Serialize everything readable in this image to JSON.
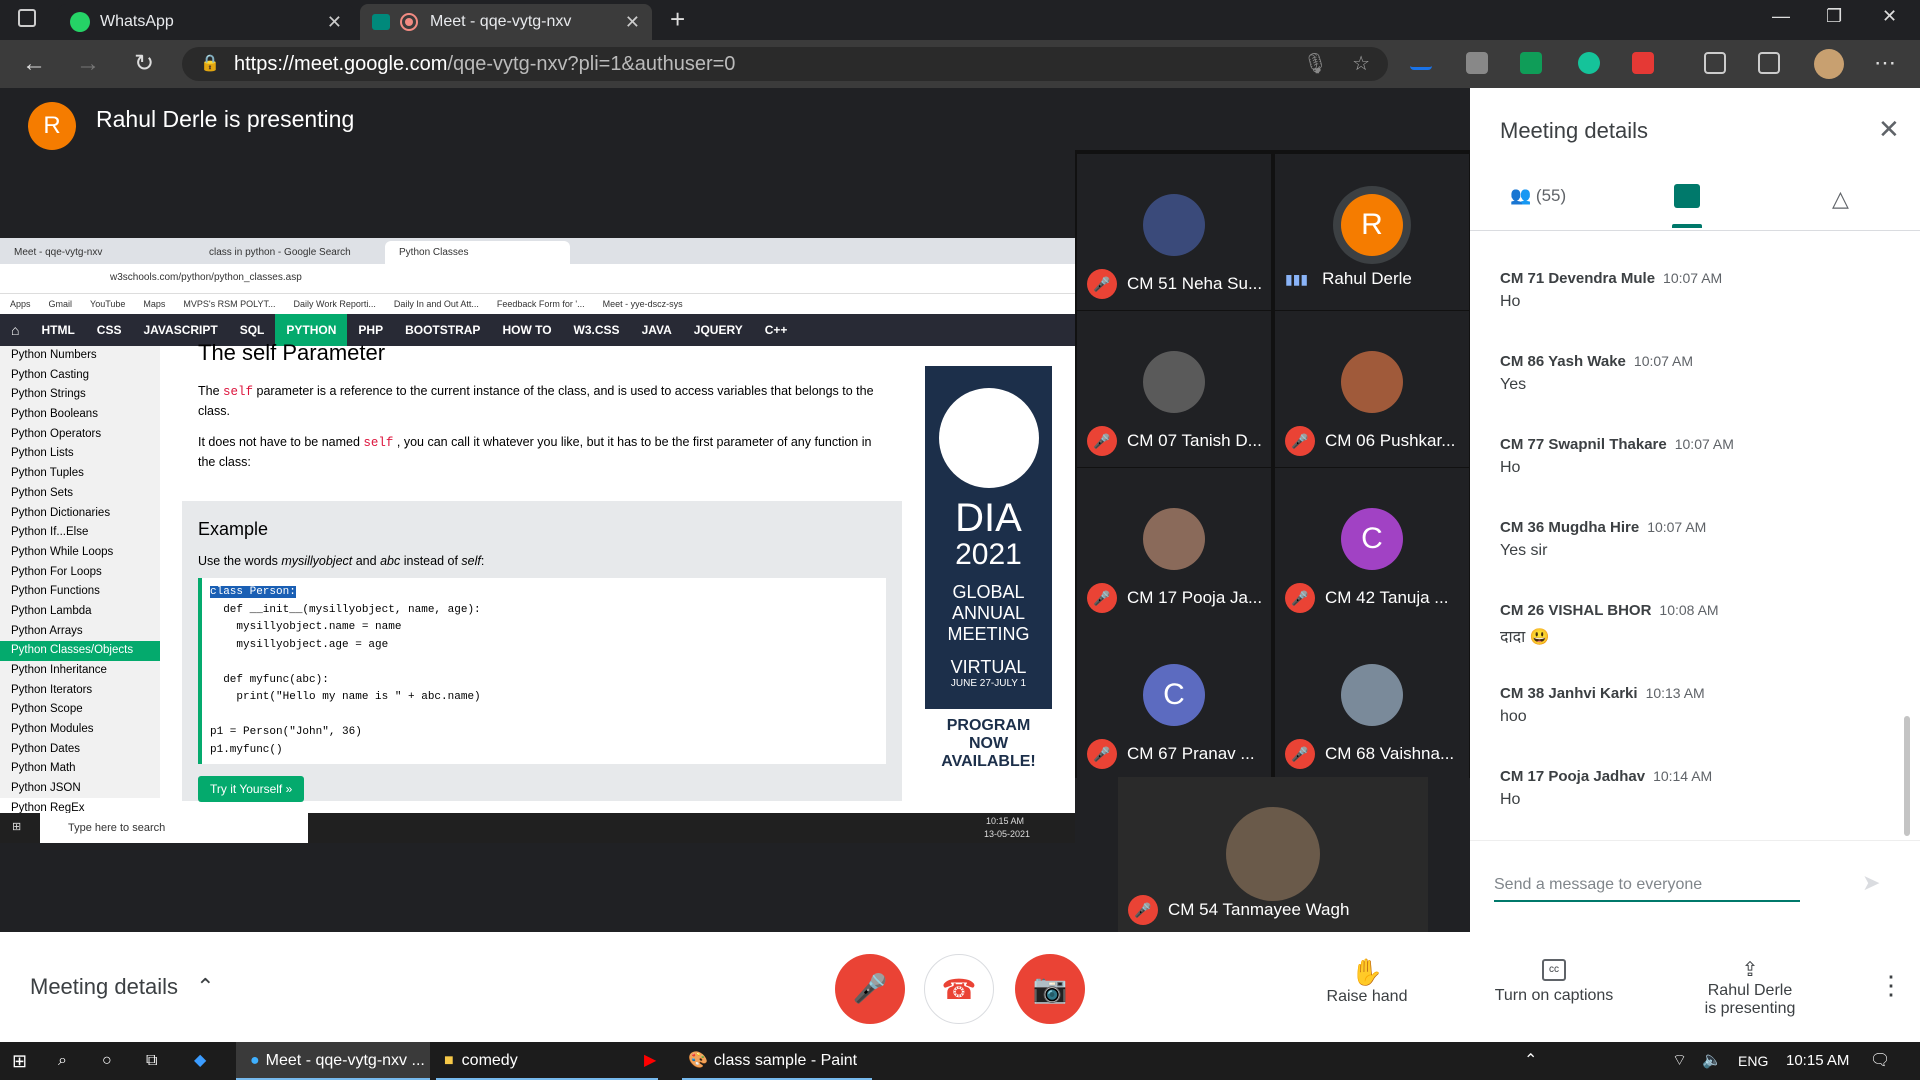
{
  "browser": {
    "tabs": [
      {
        "label": "WhatsApp"
      },
      {
        "label": "Meet - qqe-vytg-nxv"
      }
    ],
    "url_main": "https://meet.google.com",
    "url_rest": "/qqe-vytg-nxv?pli=1&authuser=0"
  },
  "meet": {
    "presenter_initial": "R",
    "presenting_text": "Rahul Derle is presenting",
    "tiles": [
      {
        "name": "CM 51 Neha Su...",
        "initial": "",
        "color": "#3a4a7a"
      },
      {
        "name": "Rahul Derle",
        "initial": "R",
        "color": "#f57c00"
      },
      {
        "name": "CM 07 Tanish D...",
        "initial": "",
        "color": "#5a5a5a"
      },
      {
        "name": "CM 06 Pushkar...",
        "initial": "",
        "color": "#a05a3a"
      },
      {
        "name": "CM 17 Pooja Ja...",
        "initial": "",
        "color": "#8a6a5a"
      },
      {
        "name": "CM 42 Tanuja ...",
        "initial": "C",
        "color": "#a142c4"
      },
      {
        "name": "CM 67 Pranav ...",
        "initial": "C",
        "color": "#5c6bc0"
      },
      {
        "name": "CM 68 Vaishna...",
        "initial": "",
        "color": "#7a8a9a"
      },
      {
        "name": "CM 54 Tanmayee Wagh",
        "initial": "",
        "color": "#6a5a4a"
      }
    ]
  },
  "shared": {
    "tabs": [
      "Meet - qqe-vytg-nxv",
      "class in python - Google Search",
      "Python Classes"
    ],
    "url": "w3schools.com/python/python_classes.asp",
    "bookmarks": [
      "Apps",
      "Gmail",
      "YouTube",
      "Maps",
      "MVPS's RSM POLYT...",
      "Daily Work Reporti...",
      "Daily In and Out Att...",
      "Feedback Form for '...",
      "Meet - yye-dscz-sys"
    ],
    "nav": [
      "HTML",
      "CSS",
      "JAVASCRIPT",
      "SQL",
      "PYTHON",
      "PHP",
      "BOOTSTRAP",
      "HOW TO",
      "W3.CSS",
      "JAVA",
      "JQUERY",
      "C++"
    ],
    "sidebar": [
      "Python Numbers",
      "Python Casting",
      "Python Strings",
      "Python Booleans",
      "Python Operators",
      "Python Lists",
      "Python Tuples",
      "Python Sets",
      "Python Dictionaries",
      "Python If...Else",
      "Python While Loops",
      "Python For Loops",
      "Python Functions",
      "Python Lambda",
      "Python Arrays",
      "Python Classes/Objects",
      "Python Inheritance",
      "Python Iterators",
      "Python Scope",
      "Python Modules",
      "Python Dates",
      "Python Math",
      "Python JSON",
      "Python RegEx"
    ],
    "heading": "The self Parameter",
    "para1_a": "The",
    "para1_code": "self",
    "para1_b": "parameter is a reference to the current instance of the class, and is used to access variables that belongs to the class.",
    "para2_a": "It does not have to be named",
    "para2_code": "self",
    "para2_b": ", you can call it whatever you like, but it has to be the first parameter of any function in the class:",
    "example_title": "Example",
    "example_intro_a": "Use the words",
    "example_intro_i1": "mysillyobject",
    "example_intro_b": "and",
    "example_intro_i2": "abc",
    "example_intro_c": "instead of",
    "example_intro_i3": "self",
    "example_intro_d": ":",
    "code_lines": [
      "class Person:",
      "  def __init__(mysillyobject, name, age):",
      "    mysillyobject.name = name",
      "    mysillyobject.age = age",
      "",
      "  def myfunc(abc):",
      "    print(\"Hello my name is \" + abc.name)",
      "",
      "p1 = Person(\"John\", 36)",
      "p1.myfunc()"
    ],
    "try_button": "Try it Yourself »",
    "ad": [
      "DIA",
      "2021",
      "GLOBAL",
      "ANNUAL",
      "MEETING",
      "VIRTUAL",
      "JUNE 27-JULY 1",
      "PROGRAM",
      "NOW",
      "AVAILABLE!"
    ],
    "search_placeholder": "Type here to search",
    "clock_time": "10:15 AM",
    "clock_date": "13-05-2021"
  },
  "panel": {
    "title": "Meeting details",
    "people_count": "(55)",
    "messages": [
      {
        "who": "CM 71 Devendra Mule",
        "time": "10:07 AM",
        "text": "Ho"
      },
      {
        "who": "CM 86 Yash Wake",
        "time": "10:07 AM",
        "text": "Yes"
      },
      {
        "who": "CM 77 Swapnil Thakare",
        "time": "10:07 AM",
        "text": "Ho"
      },
      {
        "who": "CM 36 Mugdha Hire",
        "time": "10:07 AM",
        "text": "Yes sir"
      },
      {
        "who": "CM 26 VISHAL BHOR",
        "time": "10:08 AM",
        "text": "दादा 😃"
      },
      {
        "who": "CM 38 Janhvi Karki",
        "time": "10:13 AM",
        "text": "hoo"
      },
      {
        "who": "CM 17 Pooja Jadhav",
        "time": "10:14 AM",
        "text": "Ho"
      }
    ],
    "input_placeholder": "Send a message to everyone"
  },
  "bottom": {
    "details": "Meeting details",
    "raise_hand": "Raise hand",
    "captions": "Turn on captions",
    "presenting_1": "Rahul Derle",
    "presenting_2": "is presenting"
  },
  "taskbar": {
    "items": [
      "Meet - qqe-vytg-nxv ...",
      "comedy",
      "class sample - Paint"
    ],
    "lang": "ENG",
    "time": "10:15 AM"
  }
}
